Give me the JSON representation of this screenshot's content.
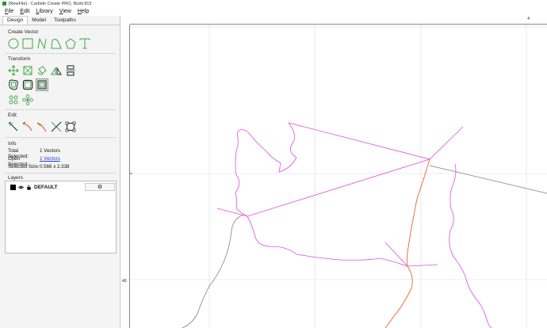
{
  "window": {
    "title": "[NewFile] - Carbide Create PRO, Build 815"
  },
  "menu": [
    "File",
    "Edit",
    "Library",
    "View",
    "Help"
  ],
  "tabs": [
    {
      "label": "Design",
      "active": true
    },
    {
      "label": "Model",
      "active": false
    },
    {
      "label": "Toolpaths",
      "active": false
    }
  ],
  "sections": {
    "create_vector": "Create Vector",
    "transform": "Transform",
    "edit": "Edit",
    "info": "Info",
    "layers": "Layers"
  },
  "icons": {
    "create_vector": [
      "circle-icon",
      "rectangle-icon",
      "polyline-icon",
      "polygon-curve-icon",
      "pentagon-icon",
      "text-icon"
    ],
    "transform_row1": [
      "move-icon",
      "scale-icon",
      "rotate-icon",
      "mirror-icon",
      "align-icon"
    ],
    "transform_row2": [
      "offset-icon",
      "boolean-union-icon",
      "boolean-subtract-icon"
    ],
    "transform_row3": [
      "array-grid-icon",
      "array-circular-icon"
    ],
    "edit": [
      "node-edit-icon",
      "trim-icon",
      "join-icon",
      "cut-icon",
      "bounding-box-icon"
    ]
  },
  "info": {
    "total_selected_label": "Total Selected:",
    "total_selected_value": "1 Vectors",
    "open_selected_label": "Open Selected:",
    "open_selected_value": "1 Vectors",
    "selected_size_label": "Selected Size:",
    "selected_size_value": "0.566 x 2.338"
  },
  "layers": [
    {
      "name": "DEFAULT",
      "color": "#000000"
    }
  ],
  "ruler": {
    "top_label": "4",
    "left_label": "40"
  },
  "colors": {
    "accent": "#3aa845",
    "magenta_path": "#e24be6",
    "orange_path": "#e8652a",
    "gray_path": "#808080"
  }
}
